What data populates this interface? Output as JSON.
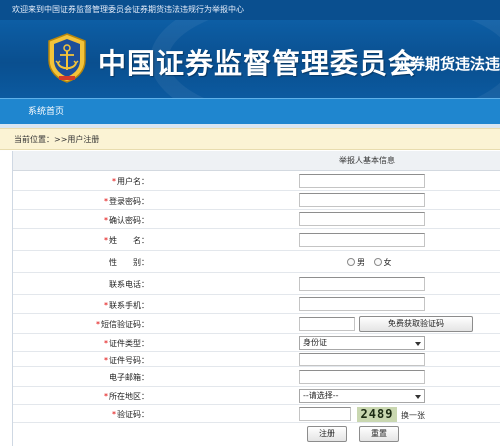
{
  "header": {
    "welcome_text": "欢迎来到中国证券监督管理委员会证券期货违法违规行为举报中心",
    "site_title": "中国证券监督管理委员会",
    "site_subtitle": "证券期货违法违"
  },
  "nav": {
    "items": [
      {
        "label": "系统首页"
      }
    ]
  },
  "breadcrumb": {
    "text": "当前位置：>>用户注册"
  },
  "form": {
    "header": "举报人基本信息",
    "fields": {
      "username": {
        "label": "用户名：",
        "required": "*"
      },
      "password": {
        "label": "登录密码：",
        "required": "*"
      },
      "confirm_password": {
        "label": "确认密码：",
        "required": "*"
      },
      "name": {
        "label": "姓　　名：",
        "required": "*"
      },
      "gender": {
        "label": "性　　别：",
        "options": [
          "男",
          "女"
        ]
      },
      "phone": {
        "label": "联系电话："
      },
      "mobile": {
        "label": "联系手机：",
        "required": "*"
      },
      "sms_code": {
        "label": "短信验证码：",
        "required": "*",
        "button": "免费获取验证码"
      },
      "id_type": {
        "label": "证件类型：",
        "required": "*",
        "selected": "身份证"
      },
      "id_number": {
        "label": "证件号码：",
        "required": "*"
      },
      "email": {
        "label": "电子邮箱："
      },
      "region": {
        "label": "所在地区：",
        "required": "*",
        "selected": "--请选择--"
      },
      "captcha": {
        "label": "验证码：",
        "required": "*",
        "code": "2489",
        "tip": "换一张"
      }
    },
    "submit_label": "注册",
    "reset_label": "重置"
  },
  "colors": {
    "banner": "#0a4f8f",
    "nav": "#1f86cf",
    "breadcrumb_bg": "#fbf3d4",
    "required": "#e00000"
  }
}
